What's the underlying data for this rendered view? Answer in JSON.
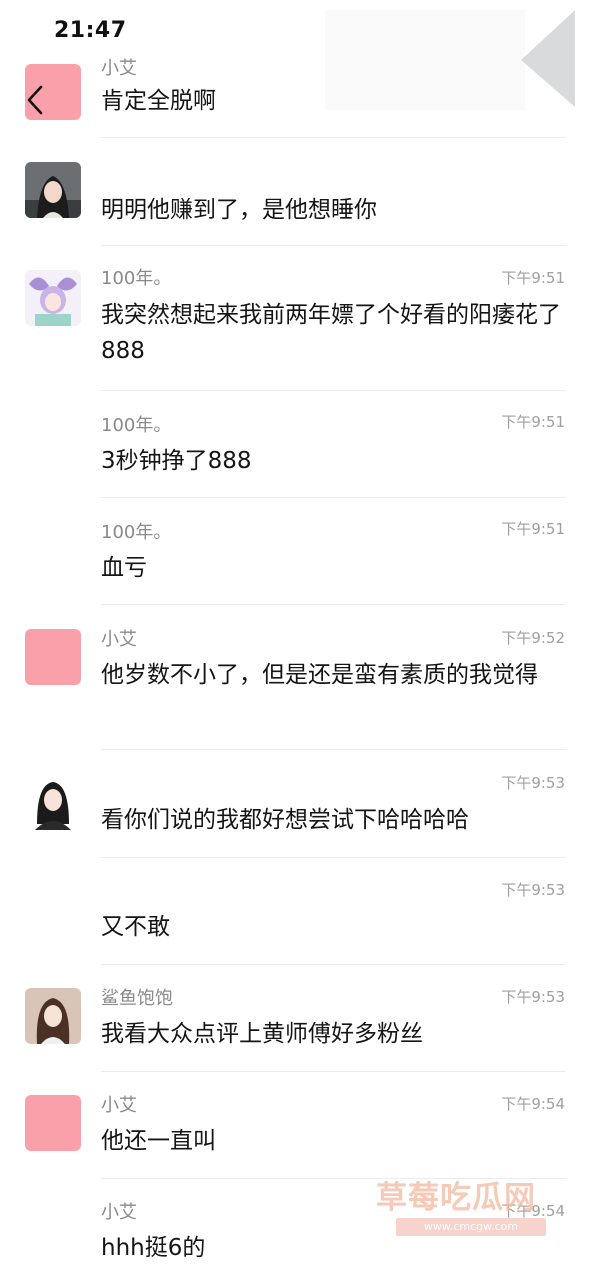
{
  "status_bar": {
    "time": "21:47"
  },
  "messages": [
    {
      "sender": "小艾",
      "time": "",
      "text": "肯定全脱啊",
      "avatar": "pink-square"
    },
    {
      "sender": "",
      "time": "",
      "text": "明明他赚到了，是他想睡你",
      "avatar": "girl-photo"
    },
    {
      "sender": "100年。",
      "time": "下午9:51",
      "text": "我突然想起来我前两年嫖了个好看的阳痿花了888",
      "avatar": "anime-butterfly"
    },
    {
      "sender": "100年。",
      "time": "下午9:51",
      "text": "3秒钟挣了888",
      "avatar": ""
    },
    {
      "sender": "100年。",
      "time": "下午9:51",
      "text": "血亏",
      "avatar": ""
    },
    {
      "sender": "小艾",
      "time": "下午9:52",
      "text": "他岁数不小了，但是还是蛮有素质的我觉得",
      "avatar": "pink-square"
    },
    {
      "sender": "",
      "time": "下午9:53",
      "text": "看你们说的我都好想尝试下哈哈哈哈",
      "avatar": "cartoon-girl"
    },
    {
      "sender": "",
      "time": "下午9:53",
      "text": "又不敢",
      "avatar": ""
    },
    {
      "sender": "鲨鱼饱饱",
      "time": "下午9:53",
      "text": "我看大众点评上黄师傅好多粉丝",
      "avatar": "girl-photo-2"
    },
    {
      "sender": "小艾",
      "time": "下午9:54",
      "text": "他还一直叫",
      "avatar": "pink-square"
    },
    {
      "sender": "小艾",
      "time": "下午9:54",
      "text": "hhh挺6的",
      "avatar": ""
    }
  ],
  "watermark": {
    "title": "草莓吃瓜网",
    "url": "www.cmcgw.com"
  },
  "icons": {
    "back": "chevron-left-icon"
  }
}
